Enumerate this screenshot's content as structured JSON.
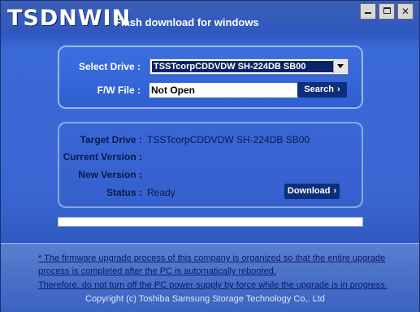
{
  "window": {
    "logo": "TSDNWIN",
    "subtitle": "Flash download for windows",
    "min_icon": "minimize-icon",
    "max_icon": "maximize-icon",
    "close_icon": "close-icon",
    "close_glyph": "✕"
  },
  "select_panel": {
    "select_drive_label": "Select Drive :",
    "selected_drive": "TSSTcorpCDDVDW SH-224DB SB00",
    "fw_file_label": "F/W File :",
    "fw_file_value": "Not Open",
    "search_label": "Search",
    "chevron": "›"
  },
  "info_panel": {
    "target_drive_label": "Target Drive :",
    "target_drive_value": "TSSTcorpCDDVDW SH-224DB SB00",
    "current_version_label": "Current Version :",
    "current_version_value": "",
    "new_version_label": "New Version :",
    "new_version_value": "",
    "status_label": "Status :",
    "status_value": "Ready",
    "download_label": "Download",
    "chevron": "›"
  },
  "progress": {
    "value": 0
  },
  "footer": {
    "note_line1": "* The firmware upgrade process of this company is organized so that the entire upgrade",
    "note_line2": "process is completed after the PC is automatically rebooted.",
    "note_line3": "Therefore, do not turn off the PC power supply by force while the upgrade is in progress.",
    "copyright": "Copyright (c) Toshiba Samsung Storage Technology Co,. Ltd"
  },
  "colors": {
    "background": "#3a66d2",
    "button": "#0d2f7a",
    "note_text": "#0a1a6a"
  }
}
